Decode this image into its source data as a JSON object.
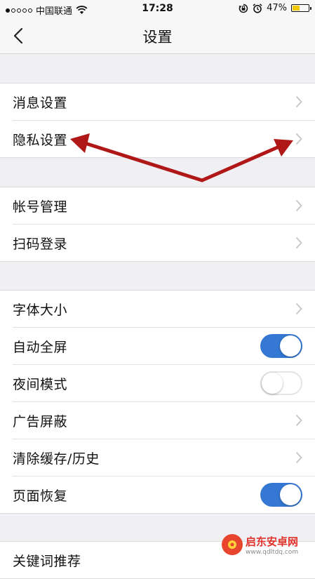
{
  "status_bar": {
    "carrier": "中国联通",
    "time": "17:28",
    "battery_percent_label": "47%",
    "battery_level": 0.47,
    "signal_bars_filled": 1,
    "signal_bars_total": 5
  },
  "nav": {
    "title": "设置",
    "back_icon": "chevron-left-icon"
  },
  "sections": [
    {
      "rows": [
        {
          "label": "消息设置",
          "control": "chevron"
        },
        {
          "label": "隐私设置",
          "control": "chevron"
        }
      ]
    },
    {
      "rows": [
        {
          "label": "帐号管理",
          "control": "chevron"
        },
        {
          "label": "扫码登录",
          "control": "chevron"
        }
      ]
    },
    {
      "rows": [
        {
          "label": "字体大小",
          "control": "chevron"
        },
        {
          "label": "自动全屏",
          "control": "toggle",
          "on": true
        },
        {
          "label": "夜间模式",
          "control": "toggle",
          "on": false
        },
        {
          "label": "广告屏蔽",
          "control": "chevron"
        },
        {
          "label": "清除缓存/历史",
          "control": "chevron"
        },
        {
          "label": "页面恢复",
          "control": "toggle",
          "on": true
        }
      ]
    },
    {
      "rows": [
        {
          "label": "关键词推荐",
          "control": "chevron"
        }
      ]
    }
  ],
  "colors": {
    "toggle_on": "#3478d3",
    "annotation_arrow": "#b01818",
    "watermark_red": "#e0322a"
  },
  "watermark": {
    "name": "启东安卓网",
    "url": "www.qdltdq.com"
  }
}
